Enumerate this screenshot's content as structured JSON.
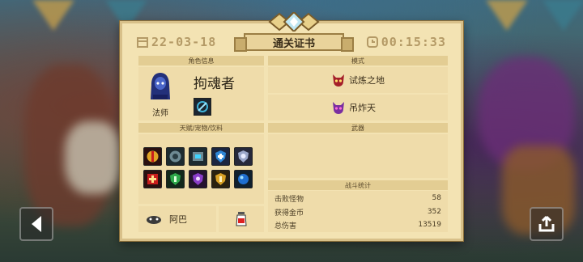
{
  "header": {
    "date": "22-03-18",
    "title": "通关证书",
    "time": "00:15:33"
  },
  "character": {
    "section_label": "角色信息",
    "class_label": "法师",
    "name": "拘魂者"
  },
  "mode": {
    "section_label": "模式",
    "items": [
      {
        "label": "试炼之地",
        "icon": "demon-skull-icon"
      },
      {
        "label": "吊炸天",
        "icon": "demon-skull-icon"
      }
    ]
  },
  "talents": {
    "section_label": "天赋/宠物/饮料",
    "icons": [
      "red-vertical-blade-icon",
      "gear-rune-icon",
      "vial-icon",
      "shield-plus-icon",
      "ghost-shield-icon",
      "health-plus-icon",
      "green-shield-icon",
      "purple-shield-icon",
      "gold-shield-icon",
      "blue-orb-icon"
    ],
    "pet_name": "阿巴"
  },
  "weapons": {
    "section_label": "武器"
  },
  "stats": {
    "section_label": "战斗统计",
    "rows": [
      {
        "label": "击败怪物",
        "value": "58"
      },
      {
        "label": "获得金币",
        "value": "352"
      },
      {
        "label": "总伤害",
        "value": "13519"
      }
    ]
  },
  "colors": {
    "paper": "#f3e3b3",
    "section_bar": "#e3cd93",
    "border": "#9b7e44",
    "date_text": "#b49a66"
  }
}
